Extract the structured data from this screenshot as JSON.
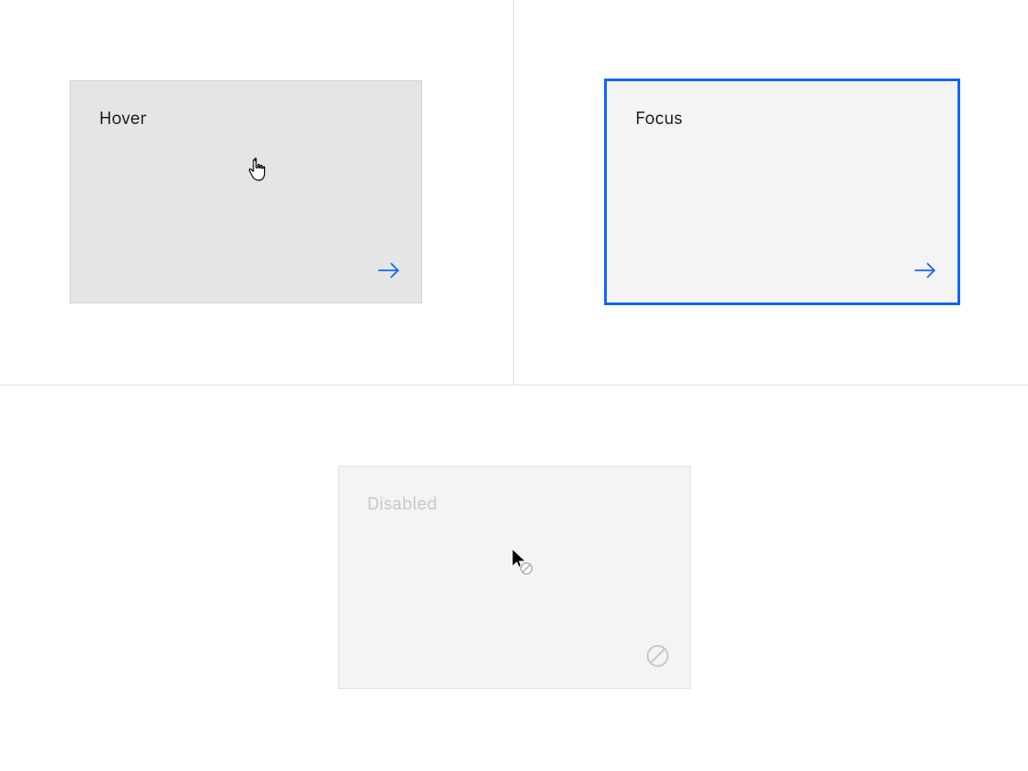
{
  "tiles": {
    "hover": {
      "label": "Hover",
      "icon": "arrow-right",
      "icon_color": "#0f62fe"
    },
    "focus": {
      "label": "Focus",
      "icon": "arrow-right",
      "icon_color": "#0f62fe"
    },
    "disabled": {
      "label": "Disabled",
      "icon": "prohibit",
      "icon_color": "#c6c6c6"
    }
  },
  "colors": {
    "focus_outline": "#0f62fe",
    "hover_bg": "#e5e5e5",
    "tile_bg": "#f4f4f4",
    "disabled_fg": "#c6c6c6",
    "text": "#161616",
    "border": "#e0e0e0"
  }
}
